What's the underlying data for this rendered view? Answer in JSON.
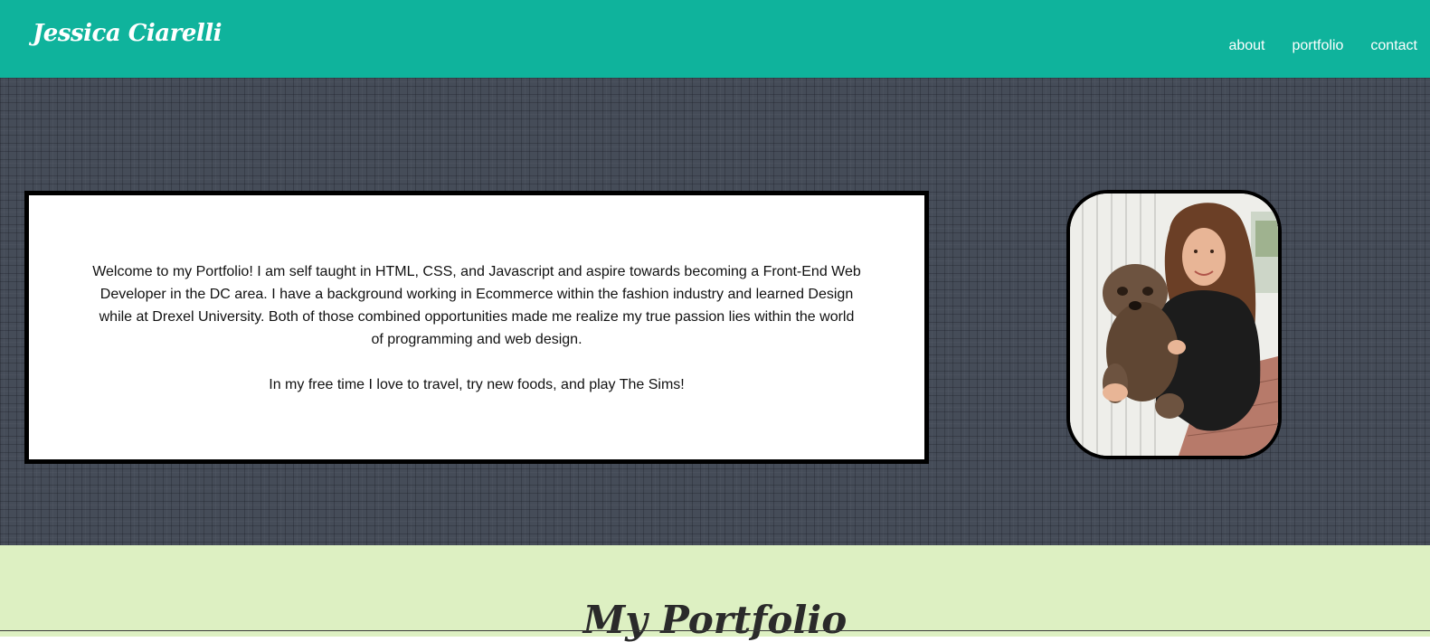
{
  "header": {
    "brand": "Jessica Ciarelli",
    "nav": [
      {
        "label": "about"
      },
      {
        "label": "portfolio"
      },
      {
        "label": "contact"
      }
    ]
  },
  "about": {
    "paragraphs": [
      "Welcome to my Portfolio! I am self taught in HTML, CSS, and Javascript and aspire towards becoming a Front-End Web Developer in the DC area. I have a background working in Ecommerce within the fashion industry and learned Design while at Drexel University. Both of those combined opportunities made me realize my true passion lies within the world of programming and web design.",
      "In my free time I love to travel, try new foods, and play The Sims!"
    ]
  },
  "portfolio": {
    "title": "My Portfolio"
  },
  "colors": {
    "header_bg": "#0fb39c",
    "hero_bg": "#454c58",
    "portfolio_bg": "#ddf0c2"
  }
}
